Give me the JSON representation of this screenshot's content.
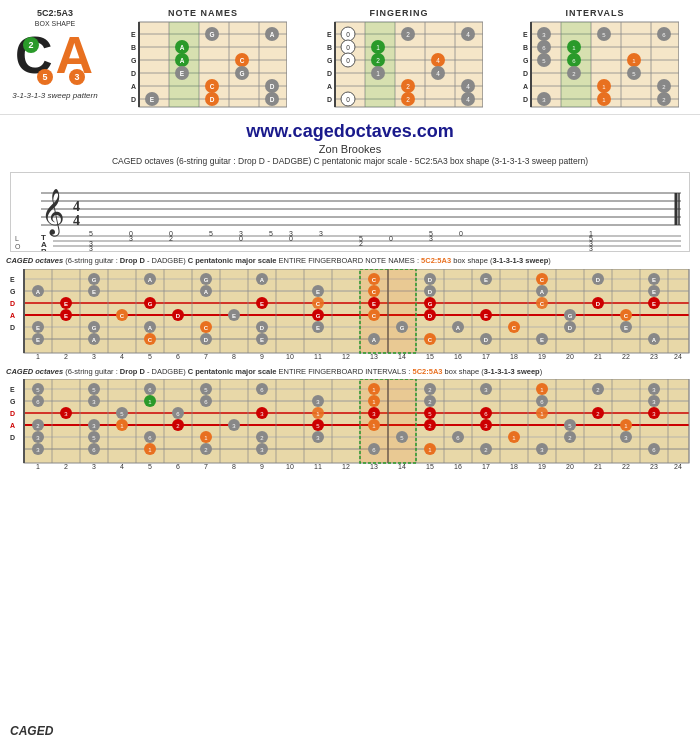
{
  "header": {
    "box_shape": "5C2:5A3",
    "box_sub": "BOX SHAPE",
    "sweep_pattern": "3-1-3-1-3 sweep pattern",
    "logo_c": "C",
    "logo_a": "A",
    "logo_green_num": "2",
    "logo_orange_num1": "5",
    "logo_orange_num2": "3"
  },
  "diagram_titles": [
    "NOTE NAMES",
    "FINGERING",
    "INTERVALS"
  ],
  "website": {
    "url": "www.cagedoctaves.com",
    "author": "Zon Brookes",
    "description": "CAGED octaves (6-string guitar : Drop D - DADGBE) C pentatonic major scale - 5C2:5A3 box shape (3-1-3-1-3 sweep pattern)"
  },
  "fingerboard1": {
    "label_parts": [
      {
        "text": "CAGED octaves",
        "style": "bold-italic"
      },
      {
        "text": " (6-string guitar : ",
        "style": "normal"
      },
      {
        "text": "Drop D",
        "style": "bold"
      },
      {
        "text": " - DADGBE) ",
        "style": "normal"
      },
      {
        "text": "C pentatonic major scale",
        "style": "bold"
      },
      {
        "text": " ENTIRE FINGERBOARD NOTE NAMES : ",
        "style": "normal"
      },
      {
        "text": "5C2:5A3",
        "style": "orange-bold"
      },
      {
        "text": " box shape (",
        "style": "normal"
      },
      {
        "text": "3-1-3-1-3 sweep",
        "style": "bold"
      },
      {
        "text": ")",
        "style": "normal"
      }
    ],
    "strings": [
      "E",
      "G",
      "D",
      "A",
      "D"
    ],
    "fret_numbers": [
      1,
      2,
      3,
      4,
      5,
      6,
      7,
      8,
      9,
      10,
      11,
      12,
      13,
      14,
      15,
      16,
      17,
      18,
      19,
      20,
      21,
      22,
      23,
      24
    ]
  },
  "fingerboard2": {
    "label_parts": [
      {
        "text": "CAGED octaves",
        "style": "bold-italic"
      },
      {
        "text": " (6-string guitar : ",
        "style": "normal"
      },
      {
        "text": "Drop D",
        "style": "bold"
      },
      {
        "text": " - DADGBE) ",
        "style": "normal"
      },
      {
        "text": "C pentatonic major scale",
        "style": "bold"
      },
      {
        "text": " ENTIRE FINGERBOARD INTERVALS : ",
        "style": "normal"
      },
      {
        "text": "5C2:5A3",
        "style": "orange-bold"
      },
      {
        "text": " box shape (",
        "style": "normal"
      },
      {
        "text": "3-1-3-1-3 sweep",
        "style": "bold"
      },
      {
        "text": ")",
        "style": "normal"
      }
    ],
    "strings": [
      "E",
      "G",
      "D",
      "A",
      "D"
    ],
    "fret_numbers": [
      1,
      2,
      3,
      4,
      5,
      6,
      7,
      8,
      9,
      10,
      11,
      12,
      13,
      14,
      15,
      16,
      17,
      18,
      19,
      20,
      21,
      22,
      23,
      24
    ]
  },
  "caged_label": "CAGED"
}
